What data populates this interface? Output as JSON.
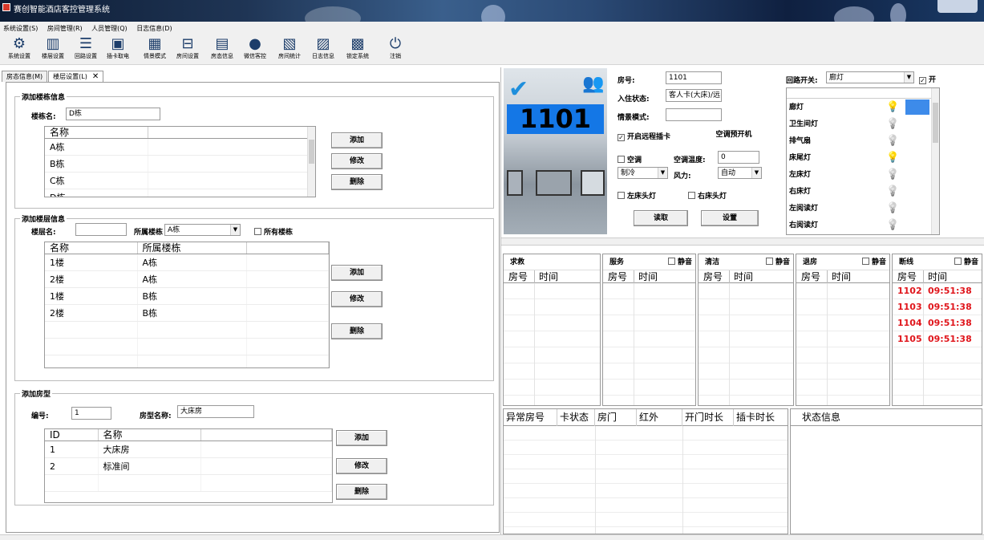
{
  "window": {
    "title": "赛创智能酒店客控管理系统"
  },
  "menu": [
    "系统设置(S)",
    "房间管理(R)",
    "人员管理(Q)",
    "日志信息(D)"
  ],
  "toolbar": [
    {
      "label": "系统设置",
      "icon": "gear-icon",
      "glyph": "⚙"
    },
    {
      "label": "楼层设置",
      "icon": "building-icon",
      "glyph": "▥"
    },
    {
      "label": "回路设置",
      "icon": "sliders-icon",
      "glyph": "☰"
    },
    {
      "label": "插卡取电",
      "icon": "card-icon",
      "glyph": "▣"
    },
    {
      "label": "情景模式",
      "icon": "grid-icon",
      "glyph": "▦"
    },
    {
      "label": "房间设置",
      "icon": "bed-icon",
      "glyph": "⊟"
    },
    {
      "label": "房态信息",
      "icon": "monitor-icon",
      "glyph": "▤"
    },
    {
      "label": "微信客控",
      "icon": "wechat-icon",
      "glyph": "●"
    },
    {
      "label": "房间统计",
      "icon": "stats-icon",
      "glyph": "▧"
    },
    {
      "label": "日志信息",
      "icon": "log-icon",
      "glyph": "▨"
    },
    {
      "label": "锁定系统",
      "icon": "lock-icon",
      "glyph": "▩"
    },
    {
      "label": "注销",
      "icon": "power-icon",
      "glyph": "⏻"
    }
  ],
  "tabs": [
    {
      "label": "房态信息(M)"
    },
    {
      "label": "楼层设置(L)"
    }
  ],
  "building": {
    "group_title": "添加楼栋信息",
    "name_label": "楼栋名:",
    "name_value": "D栋",
    "col_name": "名称",
    "rows": [
      "A栋",
      "B栋",
      "C栋",
      "D栋"
    ],
    "add": "添加",
    "edit": "修改",
    "delete": "删除"
  },
  "floor": {
    "group_title": "添加楼层信息",
    "name_label": "楼层名:",
    "name_value": "",
    "building_label": "所属楼栋",
    "building_value": "A栋",
    "all_label": "所有楼栋",
    "col_name": "名称",
    "col_building": "所属楼栋",
    "rows": [
      {
        "name": "1楼",
        "building": "A栋"
      },
      {
        "name": "2楼",
        "building": "A栋"
      },
      {
        "name": "1楼",
        "building": "B栋"
      },
      {
        "name": "2楼",
        "building": "B栋"
      }
    ],
    "add": "添加",
    "edit": "修改",
    "delete": "删除"
  },
  "roomtype": {
    "group_title": "添加房型",
    "id_label": "编号:",
    "id_value": "1",
    "name_label": "房型名称:",
    "name_value": "大床房",
    "col_id": "ID",
    "col_name": "名称",
    "rows": [
      {
        "id": "1",
        "name": "大床房"
      },
      {
        "id": "2",
        "name": "标准间"
      }
    ],
    "add": "添加",
    "edit": "修改",
    "delete": "删除"
  },
  "room": {
    "big_number": "1101",
    "room_label": "房号:",
    "room_value": "1101",
    "status_label": "入住状态:",
    "status_value": "客人卡(大床)/远",
    "scene_label": "情景模式:",
    "scene_value": "",
    "remote_card_label": "开启远程插卡",
    "ac_preopen_label": "空调预开机",
    "ac_label": "空调",
    "ac_temp_label": "空调温度:",
    "ac_temp_value": "0",
    "mode_value": "制冷",
    "fan_label": "风力:",
    "fan_value": "自动",
    "left_bedlamp_label": "左床头灯",
    "right_bedlamp_label": "右床头灯",
    "read_button": "读取",
    "set_button": "设置"
  },
  "circuit": {
    "label": "回路开关:",
    "selected": "廊灯",
    "on_label": "开",
    "rows": [
      {
        "name": "廊灯",
        "on": true
      },
      {
        "name": "卫生间灯",
        "on": false
      },
      {
        "name": "排气扇",
        "on": false
      },
      {
        "name": "床尾灯",
        "on": true
      },
      {
        "name": "左床灯",
        "on": false
      },
      {
        "name": "右床灯",
        "on": false
      },
      {
        "name": "左阅读灯",
        "on": false
      },
      {
        "name": "右阅读灯",
        "on": false
      }
    ]
  },
  "queues": [
    {
      "title": "求救",
      "mute": null,
      "col1": "房号",
      "col2": "时间",
      "rows": []
    },
    {
      "title": "服务",
      "mute": "静音",
      "col1": "房号",
      "col2": "时间",
      "rows": []
    },
    {
      "title": "清洁",
      "mute": "静音",
      "col1": "房号",
      "col2": "时间",
      "rows": []
    },
    {
      "title": "退房",
      "mute": "静音",
      "col1": "房号",
      "col2": "时间",
      "rows": []
    },
    {
      "title": "断线",
      "mute": "静音",
      "col1": "房号",
      "col2": "时间",
      "rows": [
        {
          "room": "1102",
          "time": "09:51:38"
        },
        {
          "room": "1103",
          "time": "09:51:38"
        },
        {
          "room": "1104",
          "time": "09:51:38"
        },
        {
          "room": "1105",
          "time": "09:51:38"
        }
      ]
    }
  ],
  "abnormal": {
    "cols": [
      "异常房号",
      "卡状态",
      "房门",
      "红外",
      "开门时长",
      "插卡时长"
    ]
  },
  "status": {
    "title": "状态信息"
  },
  "colors": {
    "accent_blue": "#1477e6",
    "offline_red": "#e0161c",
    "bulb_on": "#f3e21b"
  }
}
